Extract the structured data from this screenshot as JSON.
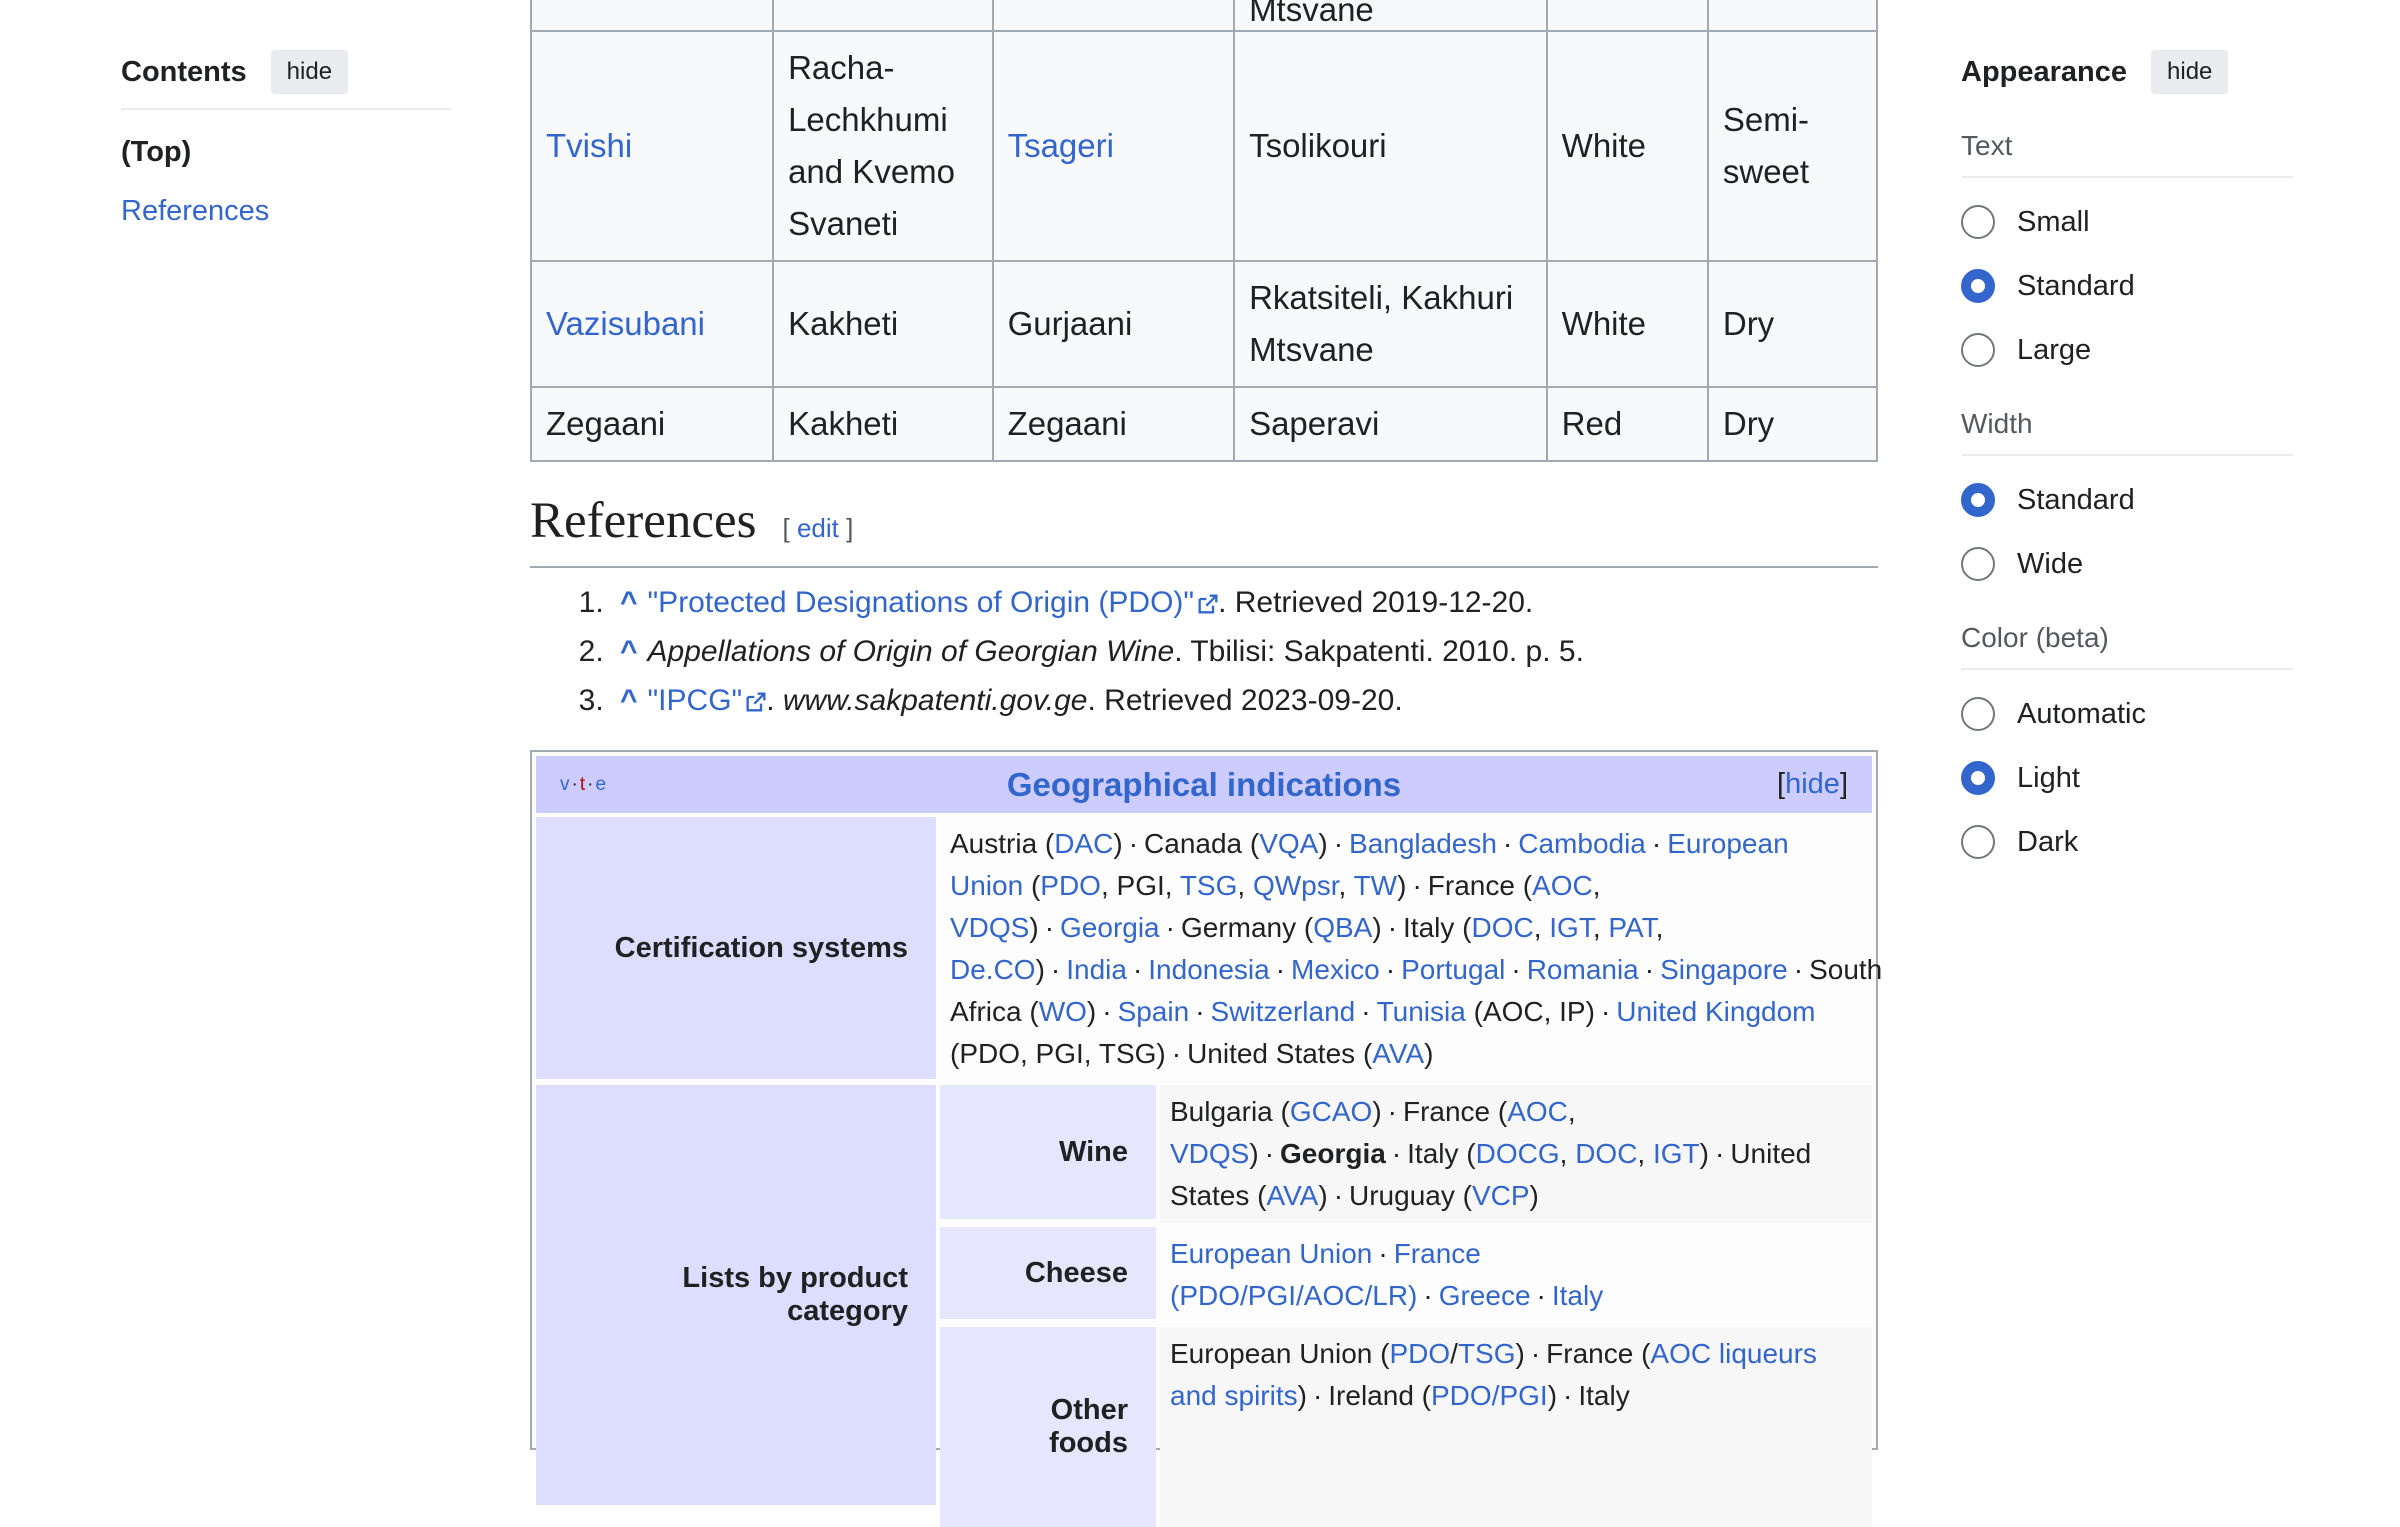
{
  "toc": {
    "title": "Contents",
    "hide_label": "hide",
    "items": [
      "(Top)",
      "References"
    ]
  },
  "appearance": {
    "title": "Appearance",
    "hide_label": "hide",
    "sections": [
      {
        "label": "Text",
        "options": [
          "Small",
          "Standard",
          "Large"
        ],
        "selected": "Standard"
      },
      {
        "label": "Width",
        "options": [
          "Standard",
          "Wide"
        ],
        "selected": "Standard"
      },
      {
        "label": "Color (beta)",
        "options": [
          "Automatic",
          "Light",
          "Dark"
        ],
        "selected": "Light"
      }
    ]
  },
  "table": {
    "partial_top_cell": "Mtsvane",
    "rows": [
      {
        "name": "Tvishi",
        "region": "Racha-Lechkhumi and Kvemo Svaneti",
        "district": "Tsageri",
        "grapes": "Tsolikouri",
        "color": "White",
        "style": "Semi-sweet"
      },
      {
        "name": "Vazisubani",
        "region": "Kakheti",
        "district": "Gurjaani",
        "grapes": "Rkatsiteli, Kakhuri Mtsvane",
        "color": "White",
        "style": "Dry"
      },
      {
        "name": "Zegaani",
        "region": "Kakheti",
        "district": "Zegaani",
        "grapes": "Saperavi",
        "color": "Red",
        "style": "Dry"
      }
    ]
  },
  "references": {
    "heading": "References",
    "edit_open": "[ ",
    "edit_label": "edit",
    "edit_close": " ]",
    "caret": "^",
    "items": [
      {
        "link": "\"Protected Designations of Origin (PDO)\"",
        "rest": ". Retrieved 2019-12-20."
      },
      {
        "italic": "Appellations of Origin of Georgian Wine",
        "rest": ". Tbilisi: Sakpatenti. 2010. p. 5."
      },
      {
        "link": "\"IPCG\"",
        "italic": "www.sakpatenti.gov.ge",
        "sep": ". ",
        "rest": ". Retrieved 2023-09-20."
      }
    ]
  },
  "navbox": {
    "vte": [
      "v",
      "t",
      "e"
    ],
    "title": "Geographical indications",
    "hide_label": "hide",
    "groups": {
      "certification": "Certification systems",
      "lists": "Lists by product category",
      "wine": "Wine",
      "cheese": "Cheese",
      "other": "Other foods"
    }
  }
}
